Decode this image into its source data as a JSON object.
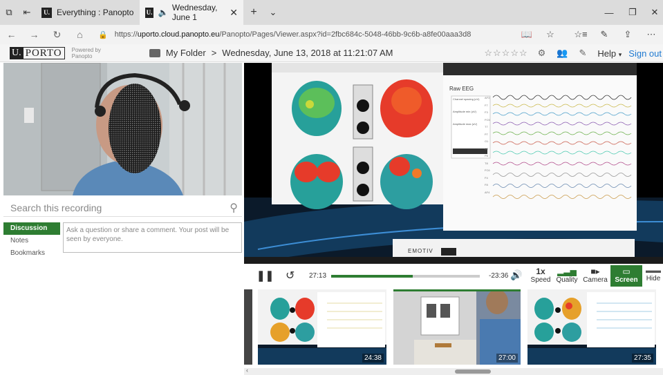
{
  "tabs": [
    {
      "label": "Everything : Panopto",
      "favicon": "U."
    },
    {
      "label": "Wednesday, June 1",
      "favicon": "U."
    }
  ],
  "address": {
    "url_prefix": "https://",
    "url_host": "uporto.cloud.panopto.eu",
    "url_path": "/Panopto/Pages/Viewer.aspx?id=2fbc684c-5048-46bb-9c6b-a8fe00aaa3d8"
  },
  "header": {
    "logo_u": "U.",
    "logo_porto": "PORTO",
    "powered_line1": "Powered by",
    "powered_line2": "Panopto",
    "folder": "My Folder",
    "separator": ">",
    "title": "Wednesday, June 13, 2018 at 11:21:07 AM",
    "stars": "☆☆☆☆☆",
    "help": "Help",
    "help_caret": "▾",
    "signout": "Sign out"
  },
  "search": {
    "placeholder": "Search this recording"
  },
  "sidebar": {
    "items": [
      {
        "label": "Discussion",
        "active": true
      },
      {
        "label": "Notes",
        "active": false
      },
      {
        "label": "Bookmarks",
        "active": false
      }
    ]
  },
  "comment": {
    "placeholder": "Ask a question or share a comment. Your post will be seen by everyone."
  },
  "player": {
    "current_time": "27:13",
    "remaining_time": "-23:36",
    "progress": 0.55,
    "speed_value": "1x",
    "speed_label": "Speed",
    "quality_label": "Quality",
    "camera_label": "Camera",
    "screen_label": "Screen",
    "hide_label": "Hide"
  },
  "screen": {
    "eeg_title": "Raw EEG",
    "emotiv": "EMOTIV",
    "channel_spacing": "Channel spacing (uV)",
    "amp_min": "Amplitude min (uV)",
    "amp_max": "Amplitude max (uV)",
    "channels": [
      "AF3",
      "F7",
      "F3",
      "FC5",
      "T7",
      "P7",
      "O1",
      "O2",
      "P8",
      "T8",
      "FC6",
      "F4",
      "F8",
      "AF4"
    ]
  },
  "thumbs": [
    {
      "time": "24:38"
    },
    {
      "time": "27:00"
    },
    {
      "time": "27:35"
    }
  ],
  "colors": {
    "accent_green": "#2e7d32",
    "link_blue": "#1f7ad1"
  }
}
